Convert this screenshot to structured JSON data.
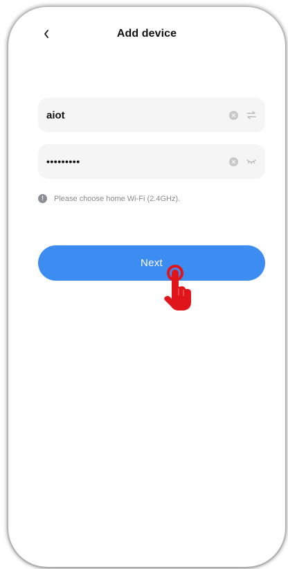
{
  "header": {
    "back_icon": "chevron-left-icon",
    "title": "Add device"
  },
  "wifi_form": {
    "ssid": {
      "value": "aiot",
      "clear_icon": "clear-circle-icon",
      "switch_icon": "swap-arrows-icon"
    },
    "password": {
      "value": "•••••••••",
      "clear_icon": "clear-circle-icon",
      "visibility_icon": "eye-closed-icon"
    },
    "hint": {
      "icon": "info-icon",
      "text": "Please choose home Wi-Fi (2.4GHz)."
    }
  },
  "next_button": {
    "label": "Next",
    "color": "#3d8cf2"
  },
  "tap_indicator": {
    "icon": "pointing-hand-icon",
    "color": "#e0141b"
  }
}
